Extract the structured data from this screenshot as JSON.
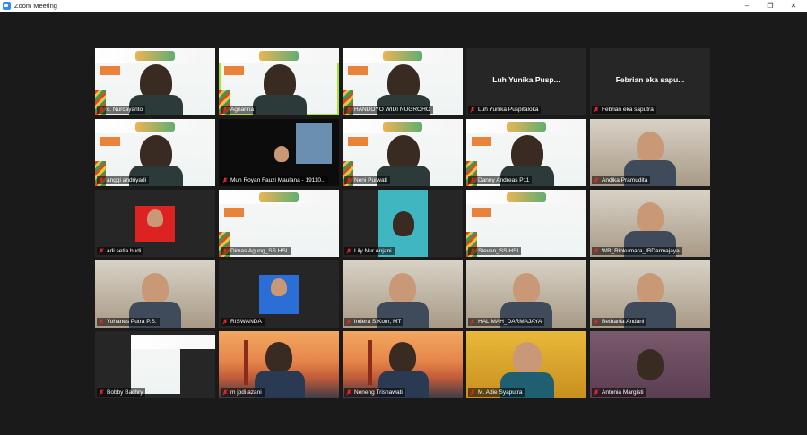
{
  "window": {
    "title": "Zoom Meeting",
    "minimize": "–",
    "maximize": "❐",
    "close": "✕"
  },
  "tiles": [
    {
      "name": "c. Nurcayanto",
      "center": ""
    },
    {
      "name": "Agnarina",
      "center": ""
    },
    {
      "name": "HANDOYO WIDI NUGROHO",
      "center": ""
    },
    {
      "name": "Luh Yunika Puspitaloka",
      "center": "Luh Yunika Pusp..."
    },
    {
      "name": "Febrian eka saputra",
      "center": "Febrian eka sapu..."
    },
    {
      "name": "anggi andriyadi",
      "center": ""
    },
    {
      "name": "Muh Royan Fauzi Maulana - 19110...",
      "center": ""
    },
    {
      "name": "Neni Purwati",
      "center": ""
    },
    {
      "name": "Danny Andreas P11",
      "center": ""
    },
    {
      "name": "Andika Pramudita",
      "center": ""
    },
    {
      "name": "adi setia budi",
      "center": ""
    },
    {
      "name": "Dimas Agung_SS HSI",
      "center": ""
    },
    {
      "name": "Lily Nur Anjani",
      "center": ""
    },
    {
      "name": "Steven_SS HSI",
      "center": ""
    },
    {
      "name": "WB_Riokumara_IBDarmajaya",
      "center": ""
    },
    {
      "name": "Yohanes Putra P.S.",
      "center": ""
    },
    {
      "name": "RISWANDA",
      "center": ""
    },
    {
      "name": "indera S.Kom, MT",
      "center": ""
    },
    {
      "name": "HALIMAH_DARMAJAYA",
      "center": ""
    },
    {
      "name": "Bethania Andani",
      "center": ""
    },
    {
      "name": "Bobby Bachry",
      "center": ""
    },
    {
      "name": "m jodi azani",
      "center": ""
    },
    {
      "name": "Neneng Trisnawati",
      "center": ""
    },
    {
      "name": "M. Adie Syaputra",
      "center": ""
    },
    {
      "name": "Antonia Margisti",
      "center": ""
    }
  ],
  "colors": {
    "active_border": "#a6e22e",
    "mute_icon": "#e02828",
    "gallery_bg": "#1a1a1a"
  }
}
